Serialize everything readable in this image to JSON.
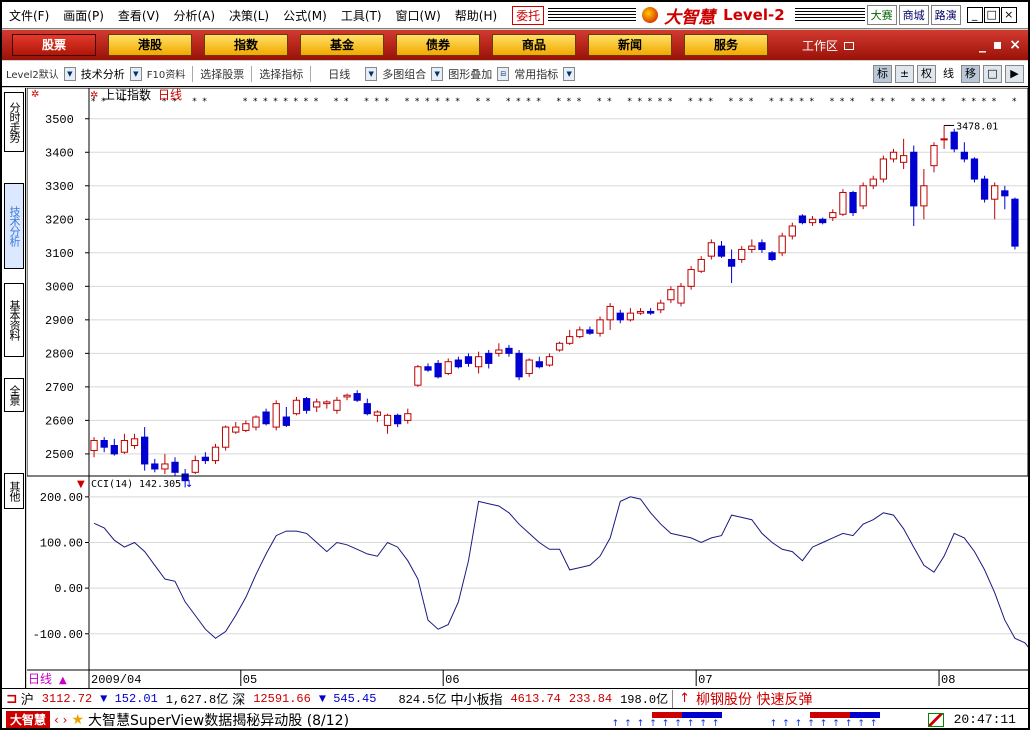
{
  "menu": [
    "文件(F)",
    "画面(P)",
    "查看(V)",
    "分析(A)",
    "决策(L)",
    "公式(M)",
    "工具(T)",
    "窗口(W)",
    "帮助(H)"
  ],
  "weituo": "委托",
  "brand": {
    "name": "大智慧",
    "level": "Level-2"
  },
  "top_buttons": [
    "大赛",
    "商城",
    "路演"
  ],
  "window_controls": [
    "_",
    "□",
    "×"
  ],
  "categories": [
    "股票",
    "港股",
    "指数",
    "基金",
    "债券",
    "商品",
    "新闻",
    "服务"
  ],
  "workzone": "工作区",
  "cat_controls": "_ ▪ ×",
  "toolbar": {
    "level2": "Level2默认",
    "tech": "技术分析",
    "f10": "F10资料",
    "select_stock": "选择股票",
    "select_indicator": "选择指标",
    "daily": "日线",
    "multi": "多图组合",
    "overlay": "图形叠加",
    "common": "常用指标",
    "right": [
      "标",
      "±",
      "权",
      "线",
      "移",
      "□",
      "▶"
    ]
  },
  "vtabs": [
    "分时走势",
    "技术分析",
    "基本资料",
    "全景",
    "其他"
  ],
  "main_chart": {
    "title": "上证指数",
    "period": "日线",
    "y_ticks": [
      3500,
      3400,
      3300,
      3200,
      3100,
      3000,
      2900,
      2800,
      2700,
      2600,
      2500
    ],
    "ylim": [
      2440,
      3550
    ],
    "high_label": "3478.01"
  },
  "cci": {
    "label": "CCI(14)",
    "value": "142.305",
    "y_ticks": [
      "200.00",
      "100.00",
      "0.00",
      "-100.00"
    ],
    "ylim": [
      -175,
      215
    ]
  },
  "x_axis": {
    "tab": "日线",
    "labels": [
      {
        "text": "2009/04",
        "i": 0
      },
      {
        "text": "05",
        "i": 15
      },
      {
        "text": "06",
        "i": 35
      },
      {
        "text": "07",
        "i": 60
      },
      {
        "text": "08",
        "i": 84
      }
    ]
  },
  "chart_data": {
    "type": "candlestick",
    "title": "上证指数",
    "ylim": [
      2440,
      3550
    ],
    "candles": [
      [
        2510,
        2540,
        2490,
        2550
      ],
      [
        2540,
        2520,
        2505,
        2550
      ],
      [
        2525,
        2500,
        2495,
        2545
      ],
      [
        2505,
        2540,
        2500,
        2560
      ],
      [
        2525,
        2545,
        2515,
        2560
      ],
      [
        2550,
        2470,
        2450,
        2580
      ],
      [
        2470,
        2455,
        2445,
        2485
      ],
      [
        2455,
        2470,
        2440,
        2500
      ],
      [
        2475,
        2445,
        2435,
        2490
      ],
      [
        2440,
        2420,
        2400,
        2455
      ],
      [
        2445,
        2480,
        2440,
        2495
      ],
      [
        2490,
        2480,
        2470,
        2505
      ],
      [
        2480,
        2520,
        2470,
        2530
      ],
      [
        2520,
        2580,
        2510,
        2585
      ],
      [
        2565,
        2580,
        2560,
        2595
      ],
      [
        2570,
        2590,
        2565,
        2600
      ],
      [
        2580,
        2610,
        2570,
        2615
      ],
      [
        2625,
        2590,
        2585,
        2635
      ],
      [
        2580,
        2650,
        2570,
        2660
      ],
      [
        2610,
        2585,
        2580,
        2640
      ],
      [
        2620,
        2660,
        2615,
        2670
      ],
      [
        2665,
        2630,
        2620,
        2670
      ],
      [
        2640,
        2655,
        2625,
        2665
      ],
      [
        2650,
        2655,
        2635,
        2660
      ],
      [
        2630,
        2660,
        2620,
        2670
      ],
      [
        2670,
        2675,
        2660,
        2680
      ],
      [
        2680,
        2660,
        2655,
        2690
      ],
      [
        2650,
        2620,
        2615,
        2665
      ],
      [
        2615,
        2625,
        2595,
        2630
      ],
      [
        2585,
        2615,
        2560,
        2620
      ],
      [
        2615,
        2590,
        2580,
        2620
      ],
      [
        2600,
        2620,
        2590,
        2635
      ],
      [
        2705,
        2760,
        2700,
        2765
      ],
      [
        2760,
        2750,
        2745,
        2770
      ],
      [
        2770,
        2730,
        2725,
        2780
      ],
      [
        2740,
        2775,
        2735,
        2785
      ],
      [
        2780,
        2760,
        2755,
        2790
      ],
      [
        2790,
        2770,
        2760,
        2800
      ],
      [
        2760,
        2790,
        2740,
        2805
      ],
      [
        2800,
        2770,
        2755,
        2810
      ],
      [
        2800,
        2810,
        2790,
        2830
      ],
      [
        2815,
        2800,
        2790,
        2825
      ],
      [
        2800,
        2730,
        2720,
        2810
      ],
      [
        2740,
        2780,
        2730,
        2785
      ],
      [
        2775,
        2760,
        2755,
        2790
      ],
      [
        2765,
        2790,
        2760,
        2800
      ],
      [
        2810,
        2830,
        2805,
        2835
      ],
      [
        2830,
        2850,
        2825,
        2870
      ],
      [
        2850,
        2870,
        2845,
        2880
      ],
      [
        2870,
        2860,
        2855,
        2880
      ],
      [
        2860,
        2900,
        2850,
        2910
      ],
      [
        2900,
        2940,
        2870,
        2950
      ],
      [
        2920,
        2900,
        2890,
        2930
      ],
      [
        2900,
        2920,
        2895,
        2935
      ],
      [
        2920,
        2925,
        2915,
        2935
      ],
      [
        2925,
        2920,
        2915,
        2935
      ],
      [
        2930,
        2950,
        2920,
        2960
      ],
      [
        2960,
        2990,
        2950,
        3000
      ],
      [
        2950,
        3000,
        2940,
        3010
      ],
      [
        3000,
        3050,
        2990,
        3060
      ],
      [
        3045,
        3080,
        3040,
        3090
      ],
      [
        3090,
        3130,
        3080,
        3140
      ],
      [
        3120,
        3090,
        3085,
        3135
      ],
      [
        3080,
        3060,
        3010,
        3110
      ],
      [
        3080,
        3110,
        3070,
        3120
      ],
      [
        3110,
        3120,
        3100,
        3140
      ],
      [
        3130,
        3110,
        3100,
        3140
      ],
      [
        3100,
        3080,
        3075,
        3105
      ],
      [
        3100,
        3150,
        3090,
        3160
      ],
      [
        3150,
        3180,
        3140,
        3190
      ],
      [
        3210,
        3190,
        3185,
        3215
      ],
      [
        3190,
        3200,
        3180,
        3210
      ],
      [
        3200,
        3190,
        3185,
        3205
      ],
      [
        3205,
        3220,
        3195,
        3230
      ],
      [
        3215,
        3280,
        3210,
        3290
      ],
      [
        3280,
        3220,
        3210,
        3285
      ],
      [
        3240,
        3300,
        3230,
        3310
      ],
      [
        3300,
        3320,
        3290,
        3330
      ],
      [
        3320,
        3380,
        3310,
        3390
      ],
      [
        3380,
        3400,
        3370,
        3410
      ],
      [
        3370,
        3390,
        3350,
        3440
      ],
      [
        3400,
        3240,
        3180,
        3420
      ],
      [
        3240,
        3300,
        3200,
        3350
      ],
      [
        3360,
        3420,
        3340,
        3430
      ],
      [
        3440,
        3440,
        3410,
        3480
      ],
      [
        3460,
        3410,
        3400,
        3470
      ],
      [
        3400,
        3380,
        3370,
        3430
      ],
      [
        3380,
        3320,
        3310,
        3385
      ],
      [
        3320,
        3260,
        3250,
        3330
      ],
      [
        3260,
        3300,
        3200,
        3310
      ],
      [
        3285,
        3270,
        3230,
        3300
      ],
      [
        3260,
        3120,
        3110,
        3265
      ]
    ],
    "cci": [
      142,
      132,
      105,
      90,
      100,
      80,
      50,
      20,
      15,
      -30,
      -60,
      -90,
      -110,
      -95,
      -60,
      -20,
      30,
      75,
      115,
      125,
      125,
      120,
      100,
      80,
      100,
      95,
      85,
      75,
      70,
      100,
      90,
      60,
      20,
      -70,
      -90,
      -80,
      -30,
      60,
      190,
      185,
      180,
      165,
      140,
      120,
      100,
      85,
      85,
      40,
      45,
      50,
      70,
      110,
      190,
      200,
      195,
      165,
      140,
      120,
      115,
      110,
      100,
      110,
      115,
      160,
      155,
      150,
      120,
      100,
      85,
      80,
      60,
      90,
      100,
      110,
      120,
      115,
      140,
      150,
      165,
      160,
      130,
      90,
      50,
      35,
      70,
      120,
      110,
      80,
      40,
      -10,
      -70,
      -110,
      -120,
      -150
    ]
  },
  "status": {
    "sh_label": "沪",
    "sh_price": "3112.72",
    "sh_change": "▼ 152.01",
    "sh_volume": "1,627.8亿",
    "sz_label": "深",
    "sz_price": "12591.66",
    "sz_change": "▼ 545.45",
    "sz_volume": "824.5亿",
    "smb_label": "中小板指",
    "smb_price": "4613.74",
    "smb_change": "233.84",
    "smb_volume": "198.0亿",
    "alert_arrow": "↑",
    "alert_text": "柳钢股份 快速反弹"
  },
  "status2": {
    "logo": "大智慧",
    "ticker": "大智慧SuperView数据揭秘异动股 (8/12)",
    "time": "20:47:11"
  }
}
